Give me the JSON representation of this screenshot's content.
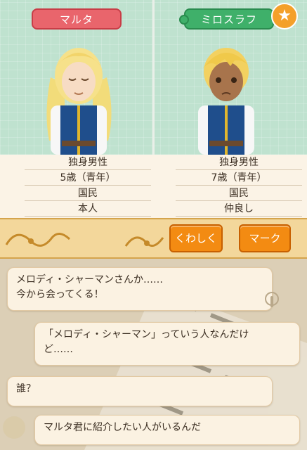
{
  "left_card": {
    "name": "マルタ",
    "info": [
      "独身男性",
      "5歳（青年）",
      "国民",
      "本人"
    ]
  },
  "right_card": {
    "name": "ミロスラフ",
    "badge_icon": "star-icon",
    "info": [
      "独身男性",
      "7歳（青年）",
      "国民",
      "仲良し"
    ]
  },
  "buttons": {
    "detail": "くわしく",
    "mark": "マーク"
  },
  "dialog": {
    "line1_a": "メロディ・シャーマンさんか……",
    "line1_b": "今から会ってくる！",
    "line2_a": "「メロディ・シャーマン」っていう人なんだけ",
    "line2_b": "ど……",
    "line3": "誰？",
    "line4": "マルタ君に紹介したい人がいるんだ"
  },
  "colors": {
    "left_pill": "#e9656c",
    "right_pill": "#3fb06a",
    "button": "#f38b12",
    "star_badge": "#f4a02a"
  }
}
